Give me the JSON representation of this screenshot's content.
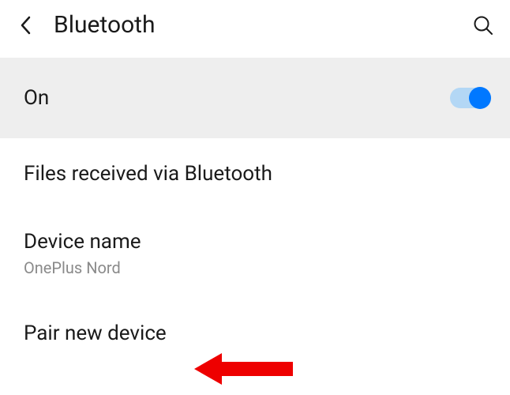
{
  "header": {
    "title": "Bluetooth"
  },
  "toggle": {
    "label": "On",
    "state": "on"
  },
  "items": {
    "filesReceived": "Files received via Bluetooth",
    "deviceName": {
      "label": "Device name",
      "value": "OnePlus Nord"
    },
    "pairNew": "Pair new device"
  }
}
